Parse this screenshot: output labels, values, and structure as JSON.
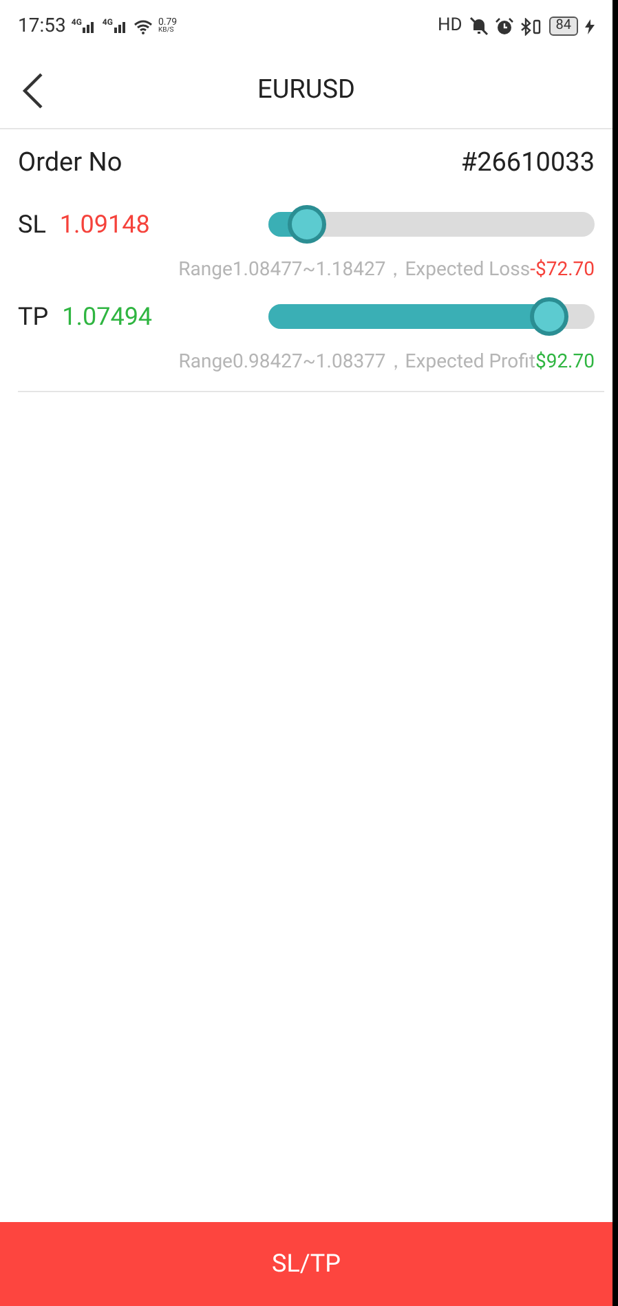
{
  "status_bar": {
    "time": "17:53",
    "networks": [
      "4G",
      "4G"
    ],
    "speed": "0.79",
    "speed_unit": "KB/S",
    "hd": "HD",
    "battery": "84"
  },
  "header": {
    "title": "EURUSD"
  },
  "order": {
    "label": "Order No",
    "value": "#26610033"
  },
  "sliders": [
    {
      "kind": "loss",
      "label": "SL",
      "value": "1.09148",
      "level": 0.12,
      "range": "Range1.08477~1.18427，Expected Loss",
      "amount": "-$72.70"
    },
    {
      "kind": "profit",
      "label": "TP",
      "value": "1.07494",
      "level": 0.86,
      "range": "Range0.98427~1.08377，Expected Profit",
      "amount": "$92.70"
    }
  ],
  "submit": "SL/TP"
}
